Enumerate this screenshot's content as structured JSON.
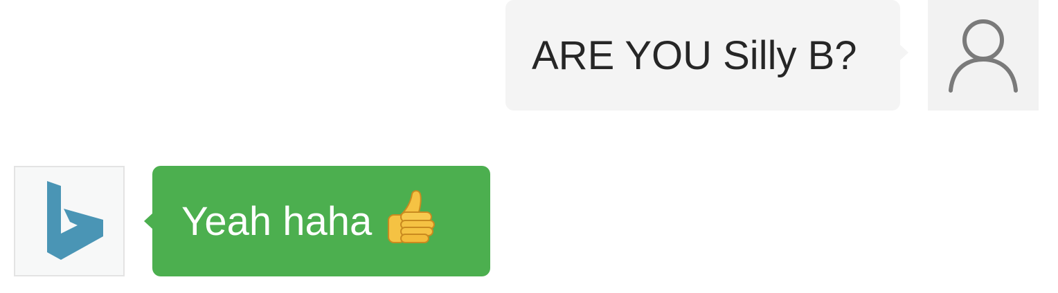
{
  "messages": {
    "outgoing": {
      "text": "ARE YOU Silly B?",
      "avatar_icon": "user-outline-icon",
      "bubble_color": "#f4f4f4"
    },
    "incoming": {
      "text": "Yeah haha",
      "emoji_icon": "thumbs-up-icon",
      "avatar_icon": "bing-logo-icon",
      "bubble_color": "#4caf4f",
      "logo_color": "#4a95b5"
    }
  }
}
